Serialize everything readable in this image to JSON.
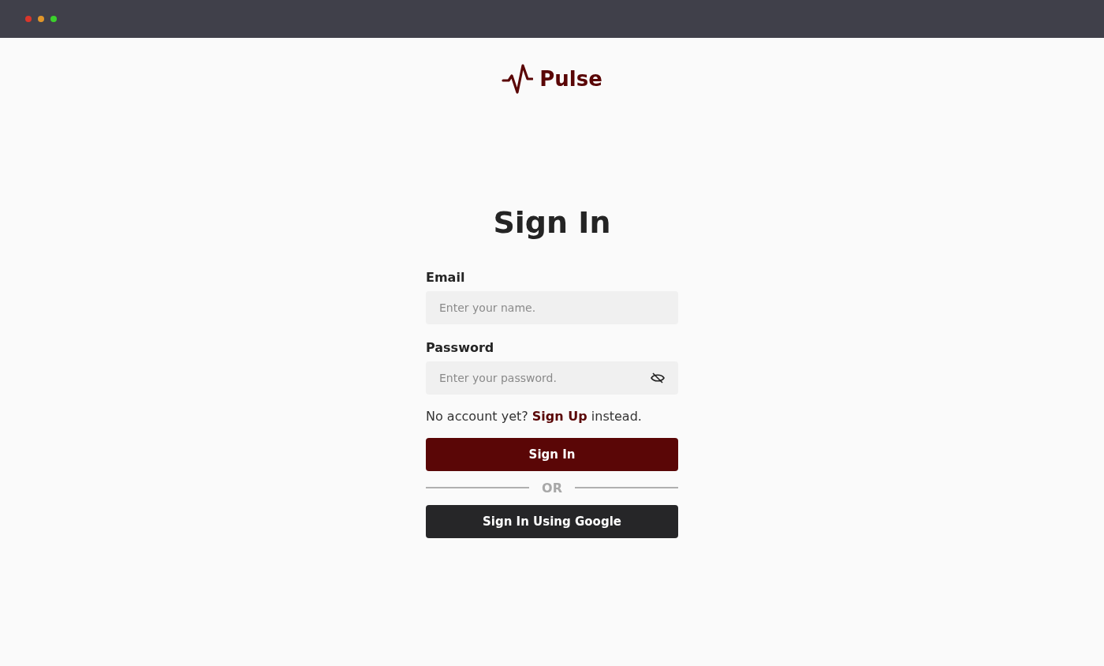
{
  "brand": {
    "name": "Pulse"
  },
  "heading": "Sign In",
  "fields": [
    {
      "label": "Email",
      "placeholder": "Enter your name.",
      "kind": "text"
    },
    {
      "label": "Password",
      "placeholder": "Enter your password.",
      "kind": "password"
    }
  ],
  "signup_prompt": {
    "before": "No account yet?",
    "link": "Sign Up",
    "after": "instead."
  },
  "buttons": [
    {
      "label": "Sign In",
      "kind": "primary"
    },
    {
      "label": "OR",
      "kind": "divider"
    },
    {
      "label": "Sign In Using Google",
      "kind": "dark"
    }
  ]
}
